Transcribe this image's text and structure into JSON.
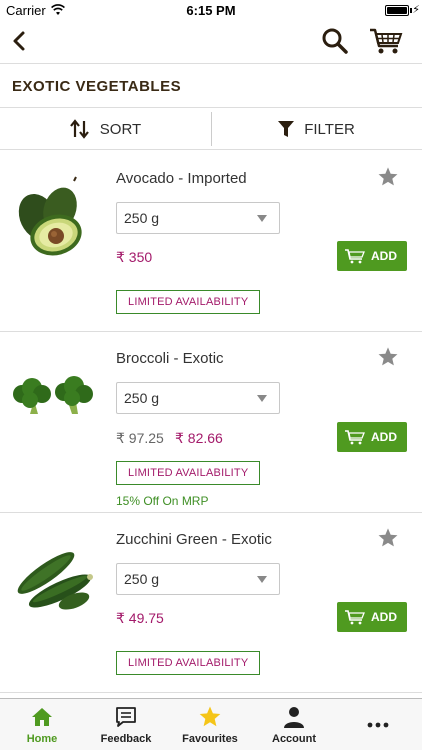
{
  "status_bar": {
    "carrier": "Carrier",
    "time": "6:15 PM"
  },
  "header": {
    "category_title": "EXOTIC VEGETABLES"
  },
  "toolbar": {
    "sort_label": "SORT",
    "filter_label": "FILTER"
  },
  "products": [
    {
      "name": "Avocado - Imported",
      "weight": "250 g",
      "price": "₹ 350",
      "add_label": "ADD",
      "badge": "LIMITED AVAILABILITY"
    },
    {
      "name": "Broccoli  -  Exotic",
      "weight": "250 g",
      "mrp": "₹ 97.25",
      "price": "₹ 82.66",
      "add_label": "ADD",
      "badge": "LIMITED AVAILABILITY",
      "discount": "15% Off On MRP"
    },
    {
      "name": "Zucchini Green  -  Exotic",
      "weight": "250 g",
      "price": "₹ 49.75",
      "add_label": "ADD",
      "badge": "LIMITED AVAILABILITY"
    }
  ],
  "tabs": [
    {
      "label": "Home",
      "icon": "home-icon",
      "active": true
    },
    {
      "label": "Feedback",
      "icon": "feedback-icon"
    },
    {
      "label": "Favourites",
      "icon": "star-icon"
    },
    {
      "label": "Account",
      "icon": "account-icon"
    },
    {
      "label": "",
      "icon": "more-icon"
    }
  ],
  "colors": {
    "accent_green": "#4f9a20",
    "price_magenta": "#a31a6a",
    "title_brown": "#3a2a15",
    "star_gray": "#8a8a8a",
    "favourites_yellow": "#f5c518"
  }
}
